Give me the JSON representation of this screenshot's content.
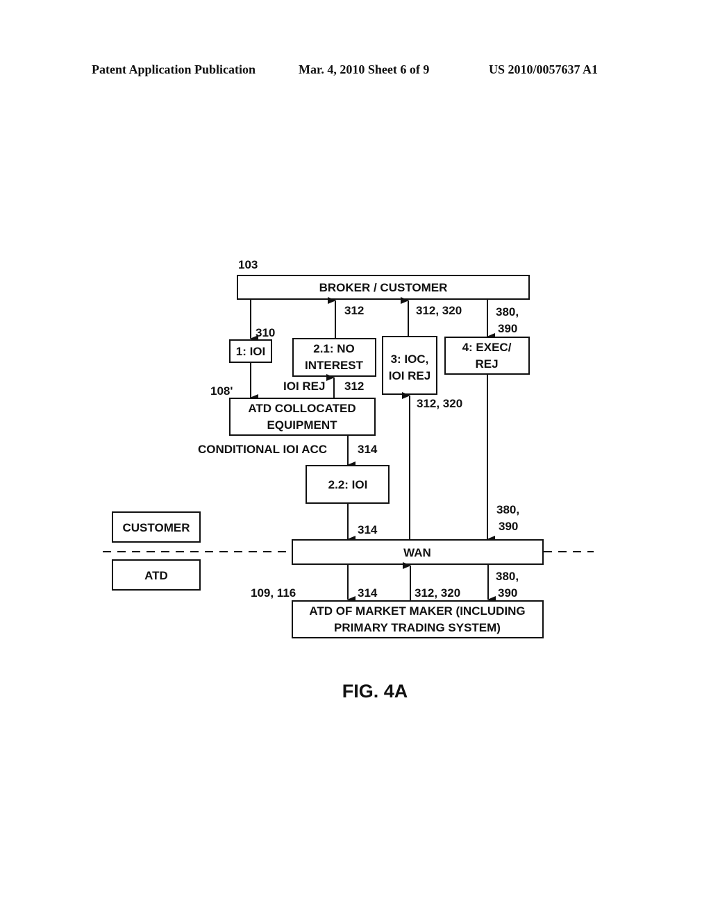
{
  "header": {
    "publication": "Patent Application Publication",
    "date_sheet": "Mar. 4, 2010   Sheet 6 of 9",
    "patent_number": "US 2010/0057637 A1"
  },
  "diagram": {
    "boxes": {
      "broker": "BROKER / CUSTOMER",
      "ioi1": "1: IOI",
      "no_interest": [
        "2.1: NO",
        "INTEREST"
      ],
      "ioc": [
        "3: IOC,",
        "IOI REJ"
      ],
      "exec": [
        "4: EXEC/",
        "REJ"
      ],
      "collocated": [
        "ATD COLLOCATED",
        "EQUIPMENT"
      ],
      "ioi22": "2.2: IOI",
      "customer_legend": "CUSTOMER",
      "atd_legend": "ATD",
      "wan": "WAN",
      "market_maker": [
        "ATD OF MARKET MAKER (INCLUDING",
        "PRIMARY TRADING SYSTEM)"
      ]
    },
    "refs": {
      "r103": "103",
      "r310": "310",
      "r312_a": "312",
      "r312_320_a": "312, 320",
      "r380_a": "380,",
      "r390_a": "390",
      "r108": "108'",
      "ioi_rej": "IOI REJ",
      "r312_b": "312",
      "r312_320_b": "312, 320",
      "cond_ioi_acc": "CONDITIONAL IOI ACC",
      "r314_a": "314",
      "r314_b": "314",
      "r380_b": "380,",
      "r390_b": "390",
      "r109_116": "109, 116",
      "r314_c": "314",
      "r312_320_c": "312, 320",
      "r380_c": "380,",
      "r390_c": "390"
    },
    "figure_label": "FIG. 4A"
  }
}
